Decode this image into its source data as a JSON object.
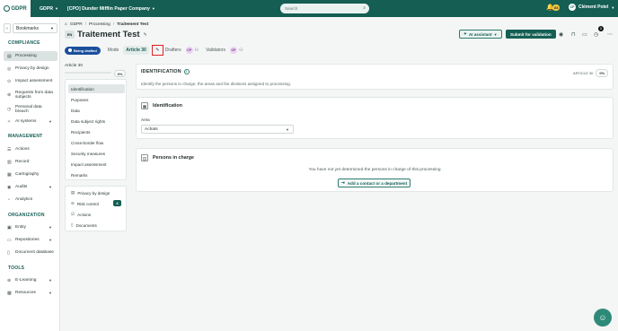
{
  "topbar": {
    "logo": "GDPR",
    "module": "GDPR",
    "company": "[CPO] Dunder Mifflin Paper Company",
    "search_placeholder": "Search",
    "notif_count": "83",
    "user_initials": "CP",
    "user_name": "Clément Potel"
  },
  "sidebar": {
    "bookmarks": "Bookmarks",
    "sections": [
      {
        "title": "COMPLIANCE",
        "items": [
          "Processing",
          "Privacy by design",
          "Impact assessment",
          "Requests from data subjects",
          "Personal data breach",
          "AI systems"
        ]
      },
      {
        "title": "MANAGEMENT",
        "items": [
          "Actions",
          "Record",
          "Cartography",
          "Audits",
          "Analytics"
        ]
      },
      {
        "title": "ORGANIZATION",
        "items": [
          "Entity",
          "Repositories",
          "Document database"
        ]
      },
      {
        "title": "TOOLS",
        "items": [
          "E-Learning",
          "Resources"
        ]
      }
    ],
    "requests_line1": "Requests from data",
    "requests_line2": "subjects",
    "breach_line1": "Personal data",
    "breach_line2": "breach"
  },
  "breadcrumb": [
    "GDPR",
    "Processing",
    "Traitement Test"
  ],
  "header": {
    "lang": "EN",
    "title": "Traitement Test",
    "status": "Being drafted",
    "mode_label": "Mode",
    "mode_value": "Article 30",
    "drafters_label": "Drafters",
    "drafter_initials": "CP",
    "validators_label": "Validators",
    "validator_initials": "CP",
    "ai_assistant": "AI assistant",
    "submit": "Submit for validation",
    "notif_badge": "1"
  },
  "leftnav": {
    "label": "Article 30",
    "progress_pct": "0%",
    "items": [
      "Identification",
      "Purposes",
      "Data",
      "Data subject rights",
      "Recipients",
      "Cross-border flow",
      "Security measures",
      "Impact assessment",
      "Remarks"
    ],
    "links": [
      "Privacy by design",
      "Risk control",
      "Actions",
      "Documents"
    ],
    "risk_count": "4"
  },
  "identification": {
    "title": "IDENTIFICATION",
    "subtitle": "Identify the persons in charge, the areas and the divisions assigned to processing.",
    "article_label": "ARTICLE 30",
    "article_pct": "0%",
    "section_title": "Identification",
    "area_label": "Area",
    "area_value": "Achats"
  },
  "persons": {
    "title": "Persons in charge",
    "empty_message": "You have not yet determined the persons in charge of this processing",
    "add_button": "Add a contact or a department"
  },
  "colors": {
    "brand": "#155e54",
    "status_blue": "#1b4f9c",
    "highlight_red": "#e02020"
  }
}
